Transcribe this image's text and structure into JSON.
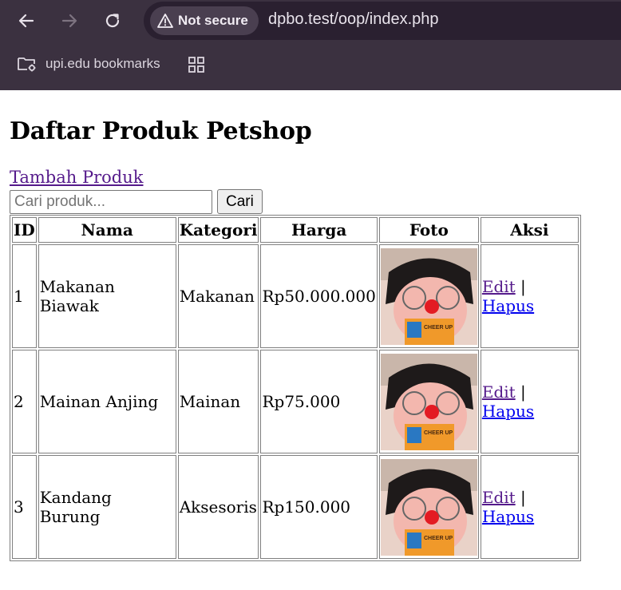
{
  "browser": {
    "security_label": "Not secure",
    "url": "dpbo.test/oop/index.php",
    "bookmark_folder": "upi.edu bookmarks"
  },
  "page": {
    "title": "Daftar Produk Petshop",
    "add_link": "Tambah Produk",
    "search_placeholder": "Cari produk...",
    "search_value": "",
    "search_button": "Cari"
  },
  "table": {
    "headers": [
      "ID",
      "Nama",
      "Kategori",
      "Harga",
      "Foto",
      "Aksi"
    ],
    "rows": [
      {
        "id": "1",
        "nama": "Makanan Biawak",
        "kategori": "Makanan",
        "harga": "Rp50.000.000"
      },
      {
        "id": "2",
        "nama": "Mainan Anjing",
        "kategori": "Mainan",
        "harga": "Rp75.000"
      },
      {
        "id": "3",
        "nama": "Kandang Burung",
        "kategori": "Aksesoris",
        "harga": "Rp150.000"
      }
    ],
    "edit_label": "Edit",
    "separator": "|",
    "delete_label": "Hapus"
  },
  "photo_text": "CHEER UP"
}
